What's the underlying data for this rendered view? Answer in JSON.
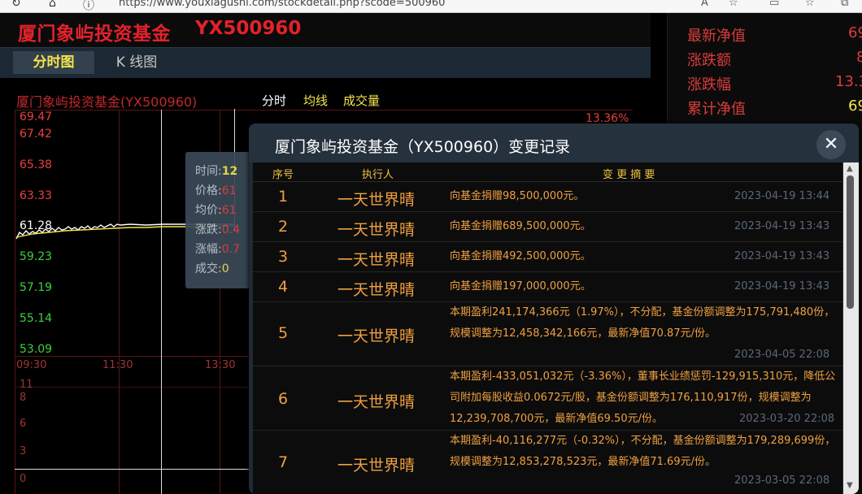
{
  "browser": {
    "url": "https://www.youxiagushi.com/stockdetail.php?scode=500960"
  },
  "fund": {
    "name": "厦门象屿投资基金",
    "code": "YX500960"
  },
  "tabs": [
    {
      "label": "分时图"
    },
    {
      "label": "K 线图"
    }
  ],
  "chart": {
    "title": "厦门象屿投资基金(YX500960)",
    "legend": [
      "分时",
      "均线",
      "成交量"
    ],
    "price_labels": [
      "69.47",
      "67.42",
      "65.38",
      "63.33",
      "61.28",
      "59.23",
      "57.19",
      "55.14",
      "53.09"
    ],
    "pct_label": "13.36%",
    "time_labels": [
      "09:30",
      "11:30",
      "13:30"
    ],
    "vol_labels": [
      "11",
      "8",
      "6",
      "3",
      "0"
    ]
  },
  "tooltip": {
    "time_label": "时间:",
    "time_value": "12",
    "price_label": "价格:",
    "price_value": "61",
    "avg_label": "均价:",
    "avg_value": "61",
    "change_label": "涨跌:",
    "change_value": "0.4",
    "pct_label": "涨幅:",
    "pct_value": "0.7",
    "vol_label": "成交:",
    "vol_value": "0"
  },
  "right_panel": {
    "rows": [
      {
        "label": "最新净值",
        "value": "69"
      },
      {
        "label": "涨跌额",
        "value": "8"
      },
      {
        "label": "涨跌幅",
        "value": "13.3"
      },
      {
        "label": "累计净值",
        "value": "69"
      }
    ]
  },
  "modal": {
    "title": "厦门象屿投资基金（YX500960）变更记录",
    "headers": {
      "no": "序号",
      "user": "执行人",
      "desc": "变 更 摘 要"
    },
    "records": [
      {
        "no": "1",
        "user": "一天世界晴",
        "desc": "向基金捐赠98,500,000元。",
        "time": "2023-04-19 13:44"
      },
      {
        "no": "2",
        "user": "一天世界晴",
        "desc": "向基金捐赠689,500,000元。",
        "time": "2023-04-19 13:43"
      },
      {
        "no": "3",
        "user": "一天世界晴",
        "desc": "向基金捐赠492,500,000元。",
        "time": "2023-04-19 13:43"
      },
      {
        "no": "4",
        "user": "一天世界晴",
        "desc": "向基金捐赠197,000,000元。",
        "time": "2023-04-19 13:43"
      },
      {
        "no": "5",
        "user": "一天世界晴",
        "desc": "本期盈利241,174,366元（1.97%），不分配，基金份额调整为175,791,480份，规模调整为12,458,342,166元，最新净值70.87元/份。",
        "time": "2023-04-05 22:08"
      },
      {
        "no": "6",
        "user": "一天世界晴",
        "desc": "本期盈利-433,051,032元（-3.36%），董事长业绩惩罚-129,915,310元，降低公司附加每股收益0.0672元/股，基金份额调整为176,110,917份，规模调整为12,239,708,700元，最新净值69.50元/份。",
        "time": "2023-03-20 22:08"
      },
      {
        "no": "7",
        "user": "一天世界晴",
        "desc": "本期盈利-40,116,277元（-0.32%），不分配，基金份额调整为179,289,699份，规模调整为12,853,278,523元，最新净值71.69元/份。",
        "time": "2023-03-05 22:08"
      }
    ]
  },
  "colors": {
    "brand_red": "#e3212b",
    "accent_yellow": "#f5e44a",
    "record_orange": "#f0a040",
    "price_up": "#e84040",
    "price_down": "#3cd23c"
  }
}
